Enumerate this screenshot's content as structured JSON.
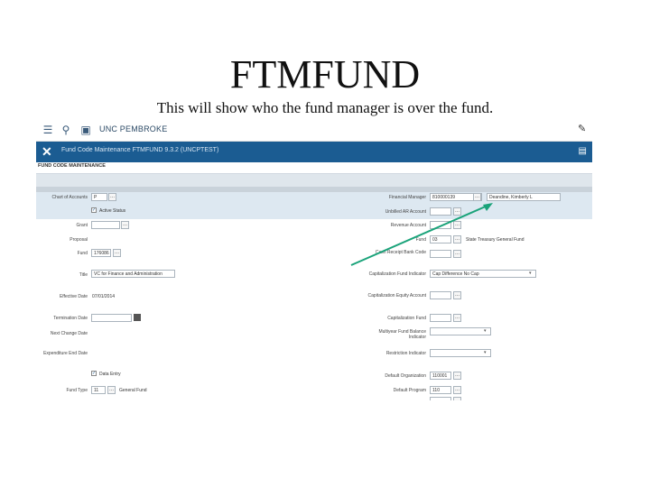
{
  "slide": {
    "title": "FTMFUND",
    "subtitle": "This will show who the fund manager is over the fund."
  },
  "app": {
    "institution": "UNC PEMBROKE",
    "form_title": "Fund Code Maintenance FTMFUND 9.3.2 (UNCPTEST)",
    "section": "FUND CODE MAINTENANCE",
    "icons": [
      "menu-icon",
      "search-icon",
      "briefcase-icon",
      "close-icon",
      "page-icon"
    ]
  },
  "form": {
    "left": [
      {
        "label": "Chart of Accounts",
        "value": "P"
      },
      {
        "label": "",
        "value": "Active Status"
      },
      {
        "label": "Grant",
        "value": ""
      },
      {
        "label": "Proposal",
        "value": ""
      },
      {
        "label": "Fund",
        "value": "176086"
      },
      {
        "label": "Title",
        "value": "VC for Finance and Administration"
      },
      {
        "label": "Effective Date",
        "value": "07/01/2014"
      },
      {
        "label": "Termination Date",
        "value": ""
      },
      {
        "label": "Next Change Date",
        "value": ""
      },
      {
        "label": "Expenditure End Date",
        "value": ""
      },
      {
        "label": "",
        "value": "Data Entry"
      },
      {
        "label": "Fund Type",
        "value": "11",
        "extra": "General Fund"
      }
    ],
    "right": [
      {
        "label": "Financial Manager",
        "value": "810000139",
        "extra": "Deandine, Kimberly L"
      },
      {
        "label": "Unbilled AR Account",
        "value": ""
      },
      {
        "label": "Revenue Account",
        "value": ""
      },
      {
        "label": "Fund",
        "value": "03",
        "extra": "State Treasury General Fund"
      },
      {
        "label": "Cash Receipt Bank Code",
        "value": ""
      },
      {
        "label": "Capitalization Fund Indicator",
        "value": "Cap Difference No Cap"
      },
      {
        "label": "Capitalization Equity Account",
        "value": ""
      },
      {
        "label": "Capitalization Fund",
        "value": ""
      },
      {
        "label": "Multiyear Fund Balance Indicator",
        "value": ""
      },
      {
        "label": "Restriction Indicator",
        "value": ""
      },
      {
        "label": "Default Organization",
        "value": "110001"
      },
      {
        "label": "Default Program",
        "value": "110"
      }
    ]
  },
  "annotation": {
    "color": "#1aa37a"
  }
}
